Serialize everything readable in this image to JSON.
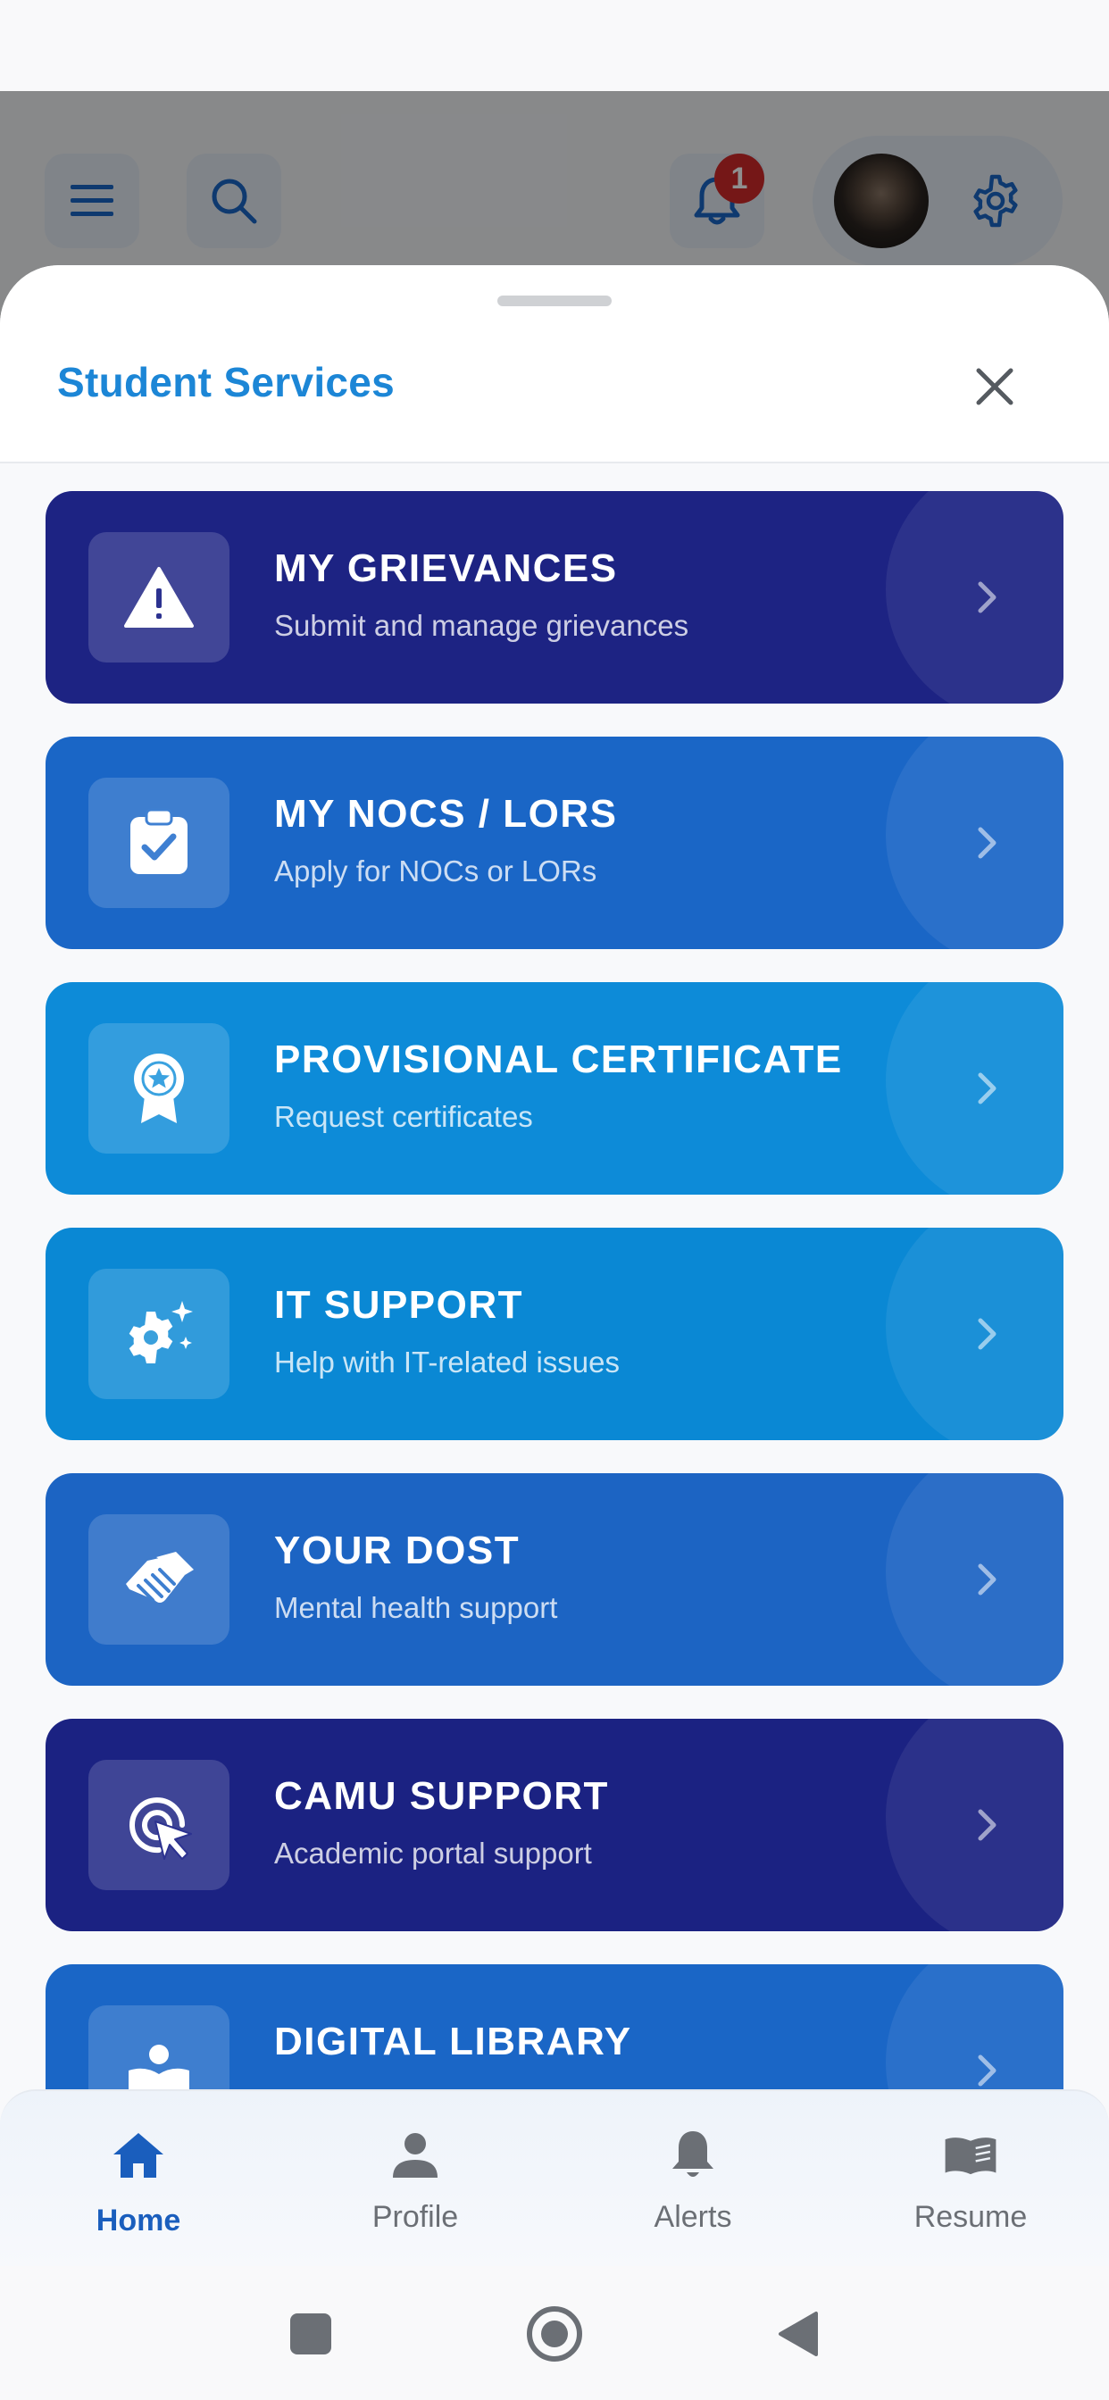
{
  "header": {
    "notification_count": "1"
  },
  "sheet": {
    "title": "Student Services"
  },
  "services": [
    {
      "title": "MY GRIEVANCES",
      "subtitle": "Submit and manage grievances",
      "icon": "warning-icon",
      "color": "#1d2383"
    },
    {
      "title": "MY NOCS / LORS",
      "subtitle": "Apply for NOCs or LORs",
      "icon": "clipboard-check-icon",
      "color": "#1a66c6"
    },
    {
      "title": "PROVISIONAL CERTIFICATE",
      "subtitle": "Request certificates",
      "icon": "award-icon",
      "color": "#0d8bd8"
    },
    {
      "title": "IT SUPPORT",
      "subtitle": "Help with IT-related issues",
      "icon": "gear-sparkle-icon",
      "color": "#0a88d4"
    },
    {
      "title": "YOUR DOST",
      "subtitle": "Mental health support",
      "icon": "handshake-icon",
      "color": "#1c64c3"
    },
    {
      "title": "CAMU SUPPORT",
      "subtitle": "Academic portal support",
      "icon": "pointer-click-icon",
      "color": "#1b2282"
    },
    {
      "title": "DIGITAL LIBRARY",
      "subtitle": "",
      "icon": "reader-icon",
      "color": "#1a66c6"
    }
  ],
  "bottom_nav": [
    {
      "label": "Home",
      "icon": "home-icon",
      "active": true
    },
    {
      "label": "Profile",
      "icon": "person-icon",
      "active": false
    },
    {
      "label": "Alerts",
      "icon": "bell-icon",
      "active": false
    },
    {
      "label": "Resume",
      "icon": "book-icon",
      "active": false
    }
  ],
  "colors": {
    "accent": "#1c86d6",
    "nav_active": "#1a5ebd",
    "badge": "#d12a2a"
  }
}
